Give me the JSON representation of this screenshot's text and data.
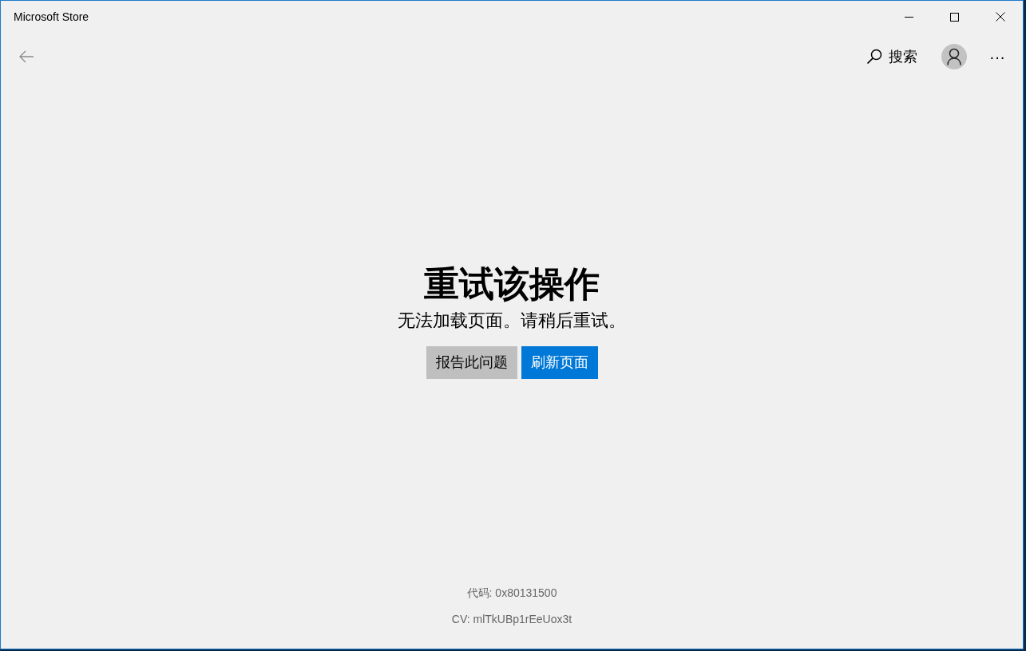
{
  "window": {
    "title": "Microsoft Store"
  },
  "toolbar": {
    "search_label": "搜索",
    "more": "···"
  },
  "error": {
    "title": "重试该操作",
    "message": "无法加载页面。请稍后重试。",
    "buttons": [
      {
        "label": "报告此问题",
        "kind": "secondary"
      },
      {
        "label": "刷新页面",
        "kind": "primary"
      }
    ]
  },
  "footer": {
    "code": "代码: 0x80131500",
    "cv": "CV: mlTkUBp1rEeUox3t"
  }
}
